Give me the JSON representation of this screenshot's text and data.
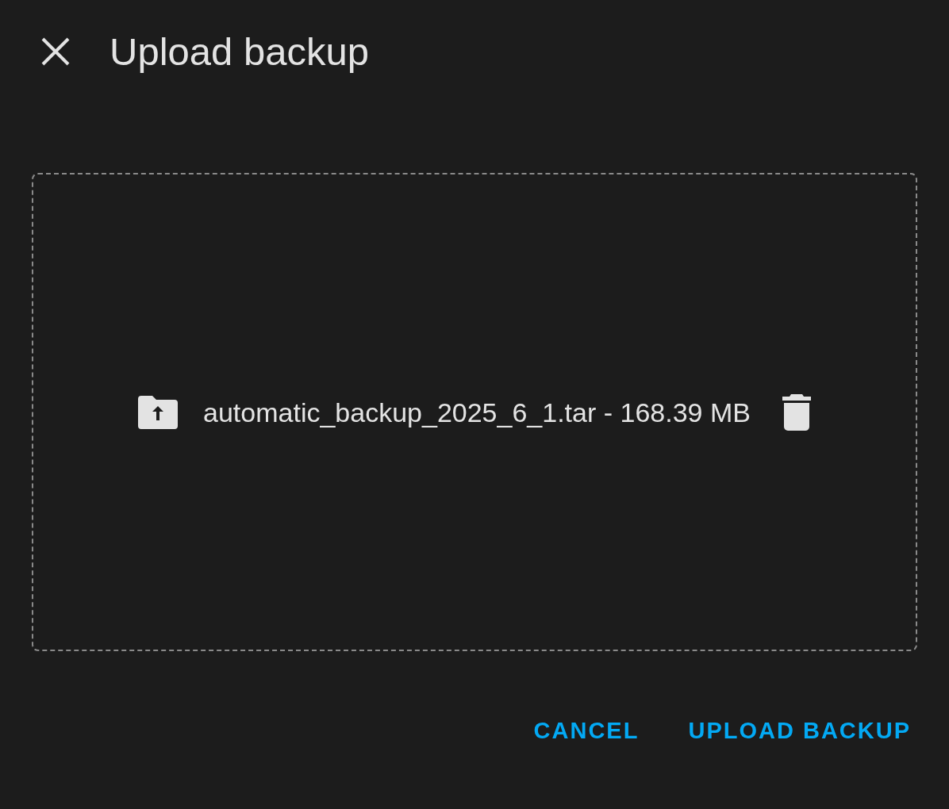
{
  "dialog": {
    "title": "Upload backup"
  },
  "dropzone": {
    "file": {
      "label": "automatic_backup_2025_6_1.tar - 168.39 MB"
    }
  },
  "buttons": [
    {
      "label": "CANCEL"
    },
    {
      "label": "UPLOAD BACKUP"
    }
  ]
}
